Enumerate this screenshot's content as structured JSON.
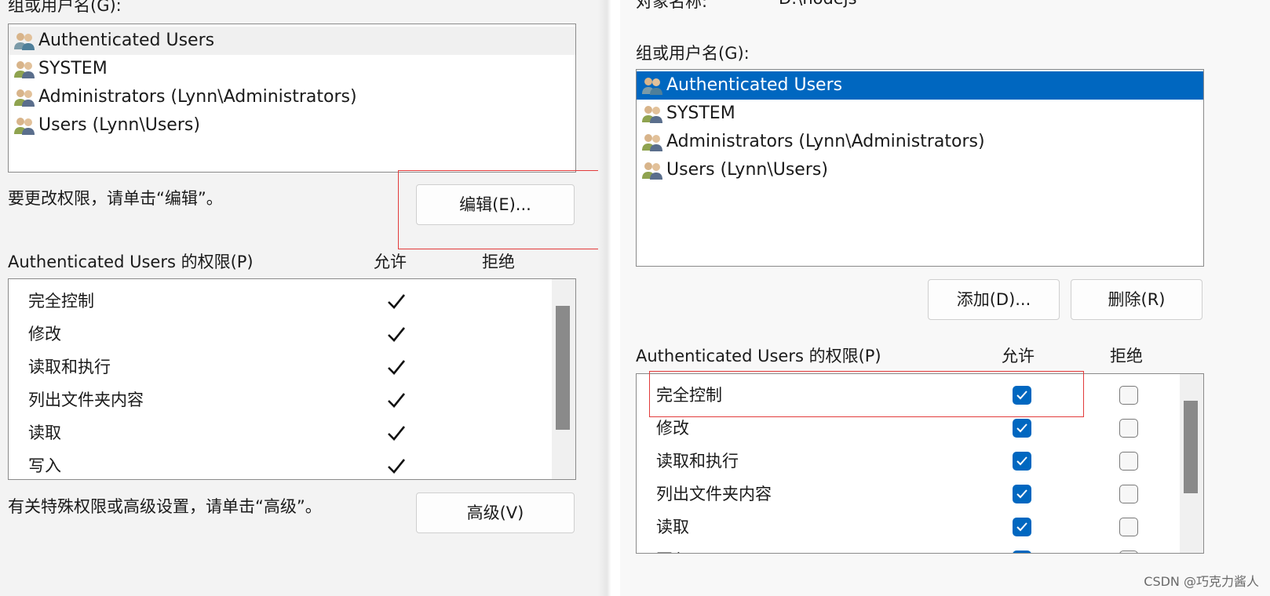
{
  "left": {
    "group_label": "组或用户名(G):",
    "users": [
      {
        "name": "Authenticated Users",
        "icon": "users-group-icon"
      },
      {
        "name": "SYSTEM",
        "icon": "users-group-icon"
      },
      {
        "name": "Administrators (Lynn\\Administrators)",
        "icon": "users-group-icon"
      },
      {
        "name": "Users (Lynn\\Users)",
        "icon": "users-group-icon"
      }
    ],
    "edit_hint": "要更改权限，请单击“编辑”。",
    "edit_button": "编辑(E)...",
    "perm_header": "Authenticated Users 的权限(P)",
    "allow_header": "允许",
    "deny_header": "拒绝",
    "permissions": [
      {
        "name": "完全控制",
        "allow": true,
        "deny": false
      },
      {
        "name": "修改",
        "allow": true,
        "deny": false
      },
      {
        "name": "读取和执行",
        "allow": true,
        "deny": false
      },
      {
        "name": "列出文件夹内容",
        "allow": true,
        "deny": false
      },
      {
        "name": "读取",
        "allow": true,
        "deny": false
      },
      {
        "name": "写入",
        "allow": true,
        "deny": false
      }
    ],
    "advanced_hint": "有关特殊权限或高级设置，请单击“高级”。",
    "advanced_button": "高级(V)"
  },
  "right": {
    "object_label": "对象名称:",
    "object_value": "D:\\nodejs",
    "group_label": "组或用户名(G):",
    "users": [
      {
        "name": "Authenticated Users",
        "selected": true,
        "icon": "users-group-icon"
      },
      {
        "name": "SYSTEM",
        "selected": false,
        "icon": "users-group-icon"
      },
      {
        "name": "Administrators (Lynn\\Administrators)",
        "selected": false,
        "icon": "users-group-icon"
      },
      {
        "name": "Users (Lynn\\Users)",
        "selected": false,
        "icon": "users-group-icon"
      }
    ],
    "add_button": "添加(D)...",
    "remove_button": "删除(R)",
    "perm_header": "Authenticated Users 的权限(P)",
    "allow_header": "允许",
    "deny_header": "拒绝",
    "permissions": [
      {
        "name": "完全控制",
        "allow": true,
        "deny": false
      },
      {
        "name": "修改",
        "allow": true,
        "deny": false
      },
      {
        "name": "读取和执行",
        "allow": true,
        "deny": false
      },
      {
        "name": "列出文件夹内容",
        "allow": true,
        "deny": false
      },
      {
        "name": "读取",
        "allow": true,
        "deny": false
      },
      {
        "name": "写入",
        "allow": true,
        "deny": false
      }
    ]
  },
  "watermark": "CSDN @巧克力酱人",
  "colors": {
    "accent": "#0067c0",
    "highlight_frame": "#e23b3b"
  }
}
